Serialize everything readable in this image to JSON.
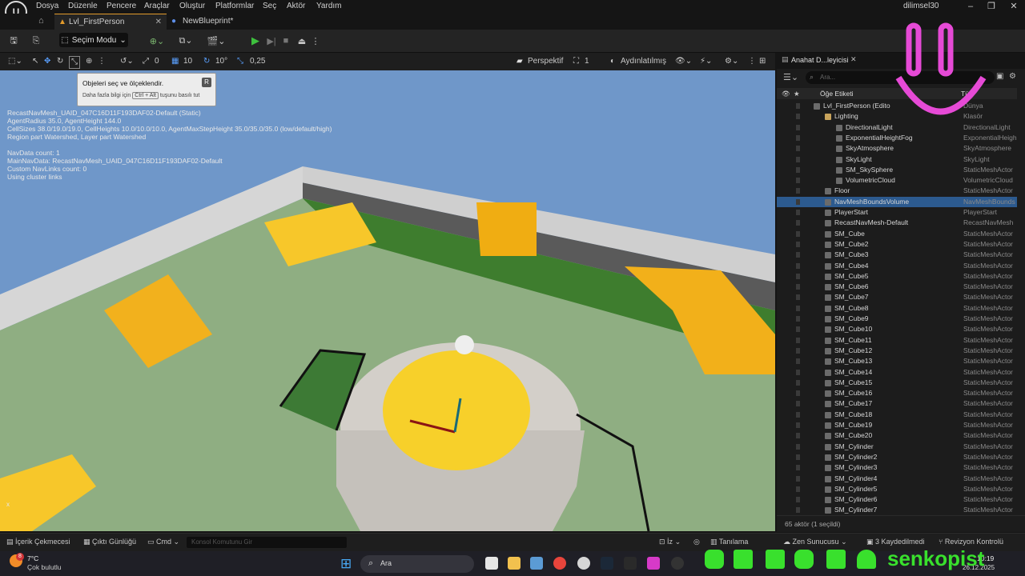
{
  "menubar": {
    "items": [
      "Dosya",
      "Düzenle",
      "Pencere",
      "Araçlar",
      "Oluştur",
      "Platformlar",
      "Seç",
      "Aktör",
      "Yardım"
    ],
    "user": "dilimsel30",
    "logo_icon": "unreal-logo-icon"
  },
  "tabs": [
    {
      "label": "Lvl_FirstPerson"
    },
    {
      "label": "NewBlueprint*"
    }
  ],
  "toolbar": {
    "mode_label": "Seçim Modu"
  },
  "viewport_toolbar": {
    "snap_rotation": "0",
    "grid_size": "10",
    "rotation_snap": "10°",
    "scale_snap": "0,25",
    "view_mode_perspective": "Perspektif",
    "camera_speed": "1",
    "lighting_mode": "Aydınlatılmış"
  },
  "tooltip": {
    "title": "Objeleri seç ve ölçeklendir.",
    "key": "R",
    "hint_prefix": "Daha fazla bilgi için",
    "hint_key": "Ctrl + Alt",
    "hint_suffix": "tuşunu basılı tut"
  },
  "stats": {
    "lines": [
      "RecastNavMesh_UAID_047C16D11F193DAF02-Default (Static)",
      "AgentRadius 35.0, AgentHeight 144.0",
      "CellSizes 38.0/19.0/19.0, CellHeights 10.0/10.0/10.0, AgentMaxStepHeight 35.0/35.0/35.0 (low/default/high)",
      "Region part Watershed, Layer part Watershed",
      "",
      "NavData count: 1",
      "MainNavData: RecastNavMesh_UAID_047C16D11F193DAF02-Default",
      "Custom NavLinks count: 0",
      "Using cluster links"
    ]
  },
  "outliner": {
    "tab_title": "Anahat D...leyicisi",
    "search_placeholder": "Ara...",
    "col_label": "Öğe Etiketi",
    "col_type": "Tü",
    "status": "65 aktör (1 seçildi)",
    "rows": [
      {
        "name": "Lvl_FirstPerson (Edito",
        "type": "Dünya",
        "depth": 0
      },
      {
        "name": "Lighting",
        "type": "Klasör",
        "depth": 1
      },
      {
        "name": "DirectionalLight",
        "type": "DirectionalLight",
        "depth": 2
      },
      {
        "name": "ExponentialHeightFog",
        "type": "ExponentialHeigh",
        "depth": 2
      },
      {
        "name": "SkyAtmosphere",
        "type": "SkyAtmosphere",
        "depth": 2
      },
      {
        "name": "SkyLight",
        "type": "SkyLight",
        "depth": 2
      },
      {
        "name": "SM_SkySphere",
        "type": "StaticMeshActor",
        "depth": 2
      },
      {
        "name": "VolumetricCloud",
        "type": "VolumetricCloud",
        "depth": 2
      },
      {
        "name": "Floor",
        "type": "StaticMeshActor",
        "depth": 1
      },
      {
        "name": "NavMeshBoundsVolume",
        "type": "NavMeshBounds",
        "depth": 1,
        "selected": true
      },
      {
        "name": "PlayerStart",
        "type": "PlayerStart",
        "depth": 1
      },
      {
        "name": "RecastNavMesh-Default",
        "type": "RecastNavMesh",
        "depth": 1
      },
      {
        "name": "SM_Cube",
        "type": "StaticMeshActor",
        "depth": 1
      },
      {
        "name": "SM_Cube2",
        "type": "StaticMeshActor",
        "depth": 1
      },
      {
        "name": "SM_Cube3",
        "type": "StaticMeshActor",
        "depth": 1
      },
      {
        "name": "SM_Cube4",
        "type": "StaticMeshActor",
        "depth": 1
      },
      {
        "name": "SM_Cube5",
        "type": "StaticMeshActor",
        "depth": 1
      },
      {
        "name": "SM_Cube6",
        "type": "StaticMeshActor",
        "depth": 1
      },
      {
        "name": "SM_Cube7",
        "type": "StaticMeshActor",
        "depth": 1
      },
      {
        "name": "SM_Cube8",
        "type": "StaticMeshActor",
        "depth": 1
      },
      {
        "name": "SM_Cube9",
        "type": "StaticMeshActor",
        "depth": 1
      },
      {
        "name": "SM_Cube10",
        "type": "StaticMeshActor",
        "depth": 1
      },
      {
        "name": "SM_Cube11",
        "type": "StaticMeshActor",
        "depth": 1
      },
      {
        "name": "SM_Cube12",
        "type": "StaticMeshActor",
        "depth": 1
      },
      {
        "name": "SM_Cube13",
        "type": "StaticMeshActor",
        "depth": 1
      },
      {
        "name": "SM_Cube14",
        "type": "StaticMeshActor",
        "depth": 1
      },
      {
        "name": "SM_Cube15",
        "type": "StaticMeshActor",
        "depth": 1
      },
      {
        "name": "SM_Cube16",
        "type": "StaticMeshActor",
        "depth": 1
      },
      {
        "name": "SM_Cube17",
        "type": "StaticMeshActor",
        "depth": 1
      },
      {
        "name": "SM_Cube18",
        "type": "StaticMeshActor",
        "depth": 1
      },
      {
        "name": "SM_Cube19",
        "type": "StaticMeshActor",
        "depth": 1
      },
      {
        "name": "SM_Cube20",
        "type": "StaticMeshActor",
        "depth": 1
      },
      {
        "name": "SM_Cylinder",
        "type": "StaticMeshActor",
        "depth": 1
      },
      {
        "name": "SM_Cylinder2",
        "type": "StaticMeshActor",
        "depth": 1
      },
      {
        "name": "SM_Cylinder3",
        "type": "StaticMeshActor",
        "depth": 1
      },
      {
        "name": "SM_Cylinder4",
        "type": "StaticMeshActor",
        "depth": 1
      },
      {
        "name": "SM_Cylinder5",
        "type": "StaticMeshActor",
        "depth": 1
      },
      {
        "name": "SM_Cylinder6",
        "type": "StaticMeshActor",
        "depth": 1
      },
      {
        "name": "SM_Cylinder7",
        "type": "StaticMeshActor",
        "depth": 1
      }
    ]
  },
  "bottombar": {
    "content_drawer": "İçerik Çekmecesi",
    "output_log": "Çıktı Günlüğü",
    "cmd": "Cmd",
    "console_placeholder": "Konsol Komutunu Gir",
    "iz": "İz",
    "derive": "Tanılama",
    "zen": "Zen Sunucusu",
    "saved": "3 Kaydedilmedi",
    "revision": "Revizyon Kontrolü"
  },
  "taskbar": {
    "weather_temp": "7°C",
    "weather_desc": "Çok bulutlu",
    "notification_count": "8",
    "search_label": "Ara",
    "time": "10:19",
    "date": "26.12.2025"
  },
  "overlay": {
    "channel_name": "senkopist",
    "accent": "#39e02d",
    "smiley_color": "#e64ad6"
  },
  "colors": {
    "accent_orange": "#e39b2b",
    "selection_blue": "#2c5a8f",
    "play_green": "#3ec13e"
  }
}
